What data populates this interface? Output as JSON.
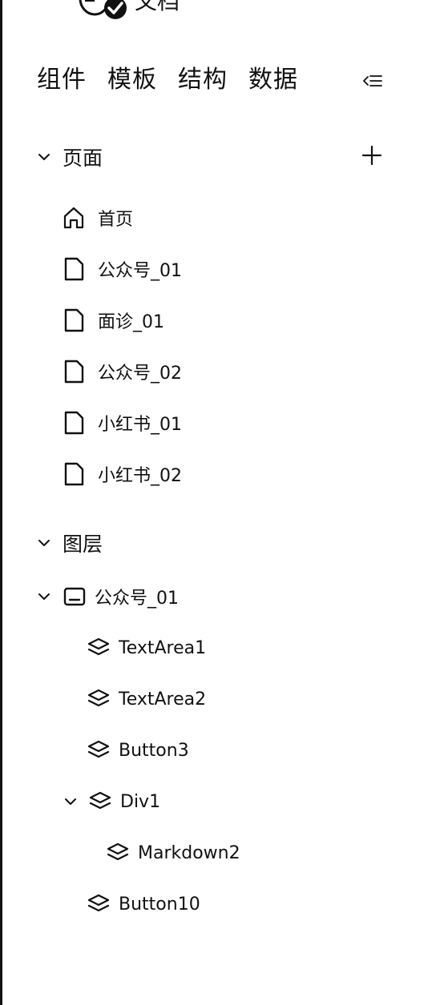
{
  "header": {
    "title": "文档",
    "logo_icon": "app-logo-icon"
  },
  "tabs": [
    {
      "label": "组件"
    },
    {
      "label": "模板"
    },
    {
      "label": "结构"
    },
    {
      "label": "数据"
    }
  ],
  "collapse_icon": "collapse-panel-icon",
  "pages_section": {
    "title": "页面",
    "add_icon": "plus-icon",
    "items": [
      {
        "label": "首页",
        "icon": "home-icon"
      },
      {
        "label": "公众号_01",
        "icon": "file-icon"
      },
      {
        "label": "面诊_01",
        "icon": "file-icon"
      },
      {
        "label": "公众号_02",
        "icon": "file-icon"
      },
      {
        "label": "小红书_01",
        "icon": "file-icon"
      },
      {
        "label": "小红书_02",
        "icon": "file-icon"
      },
      {
        "label": "",
        "icon": "file-icon"
      }
    ]
  },
  "layers_section": {
    "title": "图层",
    "root": {
      "label": "公众号_01",
      "icon": "screen-icon",
      "expanded": true
    },
    "children": [
      {
        "label": "TextArea1",
        "icon": "layers-icon"
      },
      {
        "label": "TextArea2",
        "icon": "layers-icon"
      },
      {
        "label": "Button3",
        "icon": "layers-icon"
      },
      {
        "label": "Div1",
        "icon": "layers-icon",
        "expanded": true,
        "children": [
          {
            "label": "Markdown2",
            "icon": "layers-icon"
          }
        ]
      },
      {
        "label": "Button10",
        "icon": "layers-icon"
      }
    ]
  }
}
